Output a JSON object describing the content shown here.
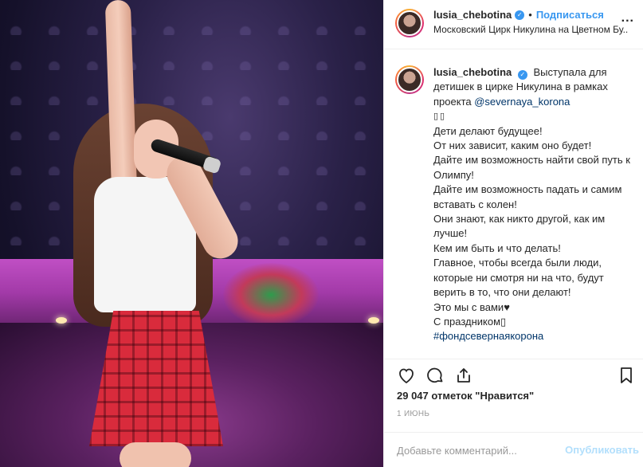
{
  "colors": {
    "accent_blue": "#3897f0",
    "link_dark_blue": "#003569",
    "text": "#262626",
    "muted": "#999999",
    "publish_disabled": "#b2dffc",
    "border": "#efefef"
  },
  "post": {
    "image_alt": "singer performing on a circus stage"
  },
  "header": {
    "username": "lusia_chebotina",
    "verified_icon": "verified-badge-icon",
    "separator": "•",
    "follow_label": "Подписаться",
    "location": "Московский Цирк Никулина на Цветном Бу...",
    "more_icon": "more-options-icon",
    "more_label": "..."
  },
  "caption": {
    "username": "lusia_chebotina",
    "intro": "Выступала для детишек в цирке Никулина в рамках проекта",
    "mention": "@severnaya_korona",
    "boxes": "▯▯",
    "lines": [
      "Дети делают будущее!",
      "От них зависит, каким оно будет!",
      "Дайте им возможность найти свой путь к Олимпу!",
      "Дайте им возможность падать и самим вставать с колен!",
      "Они знают, как никто другой, как им лучше!",
      "Кем им быть и что делать!",
      "Главное, чтобы всегда были люди, которые ни смотря ни на что, будут верить в то, что они делают!",
      "Это мы с вами♥",
      "С праздником▯"
    ],
    "hashtag": "#фондсевернаякорона"
  },
  "actions": {
    "like_icon": "heart-icon",
    "comment_icon": "comment-icon",
    "share_icon": "share-icon",
    "save_icon": "bookmark-icon"
  },
  "likes": {
    "text": "29 047 отметок \"Нравится\""
  },
  "date": {
    "text": "1 июнь"
  },
  "comment": {
    "placeholder": "Добавьте комментарий...",
    "publish_label": "Опубликовать"
  }
}
